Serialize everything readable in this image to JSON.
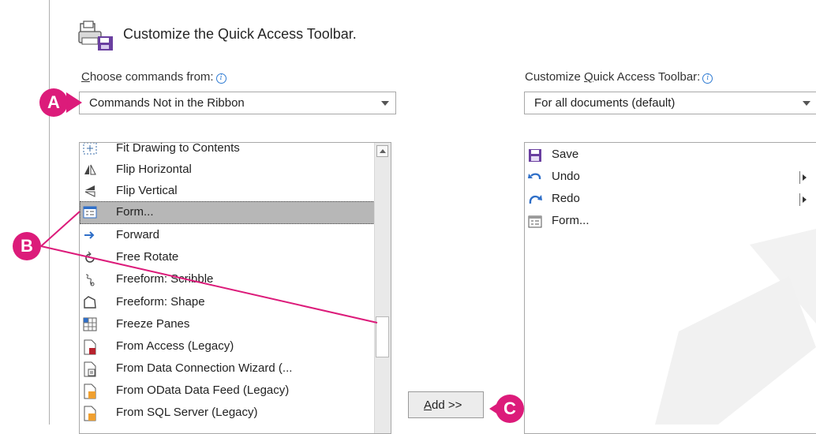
{
  "dialog": {
    "title": "Customize the Quick Access Toolbar."
  },
  "left_panel": {
    "label_prefix": "",
    "label_accel": "C",
    "label_rest": "hoose commands from:",
    "dropdown_value": "Commands Not in the Ribbon",
    "commands": [
      {
        "label": "Fit Drawing to Contents",
        "icon": "fit-drawing-icon"
      },
      {
        "label": "Flip Horizontal",
        "icon": "flip-horizontal-icon"
      },
      {
        "label": "Flip Vertical",
        "icon": "flip-vertical-icon"
      },
      {
        "label": "Form...",
        "icon": "form-icon",
        "selected": true
      },
      {
        "label": "Forward",
        "icon": "forward-arrow-icon"
      },
      {
        "label": "Free Rotate",
        "icon": "free-rotate-icon"
      },
      {
        "label": "Freeform: Scribble",
        "icon": "scribble-icon"
      },
      {
        "label": "Freeform: Shape",
        "icon": "freeform-shape-icon"
      },
      {
        "label": "Freeze Panes",
        "icon": "freeze-panes-icon"
      },
      {
        "label": "From Access (Legacy)",
        "icon": "access-file-icon"
      },
      {
        "label": "From Data Connection Wizard (...",
        "icon": "data-connection-icon"
      },
      {
        "label": "From OData Data Feed (Legacy)",
        "icon": "odata-feed-icon"
      },
      {
        "label": "From SQL Server (Legacy)",
        "icon": "sql-server-icon"
      }
    ]
  },
  "right_panel": {
    "label_before": "Customize ",
    "label_accel": "Q",
    "label_after": "uick Access Toolbar:",
    "dropdown_value": "For all documents (default)",
    "items": [
      {
        "label": "Save",
        "icon": "save-icon"
      },
      {
        "label": "Undo",
        "icon": "undo-icon",
        "has_menu": true
      },
      {
        "label": "Redo",
        "icon": "redo-icon",
        "has_menu": true
      },
      {
        "label": "Form...",
        "icon": "form-icon"
      }
    ]
  },
  "add_button": {
    "accel": "A",
    "rest": "dd >>"
  },
  "callouts": {
    "a": "A",
    "b": "B",
    "c": "C"
  },
  "colors": {
    "callout": "#dc1b7a",
    "selection": "#b7b7b7",
    "accent_blue": "#2f6fc8",
    "save_purple": "#6a3fa0"
  }
}
